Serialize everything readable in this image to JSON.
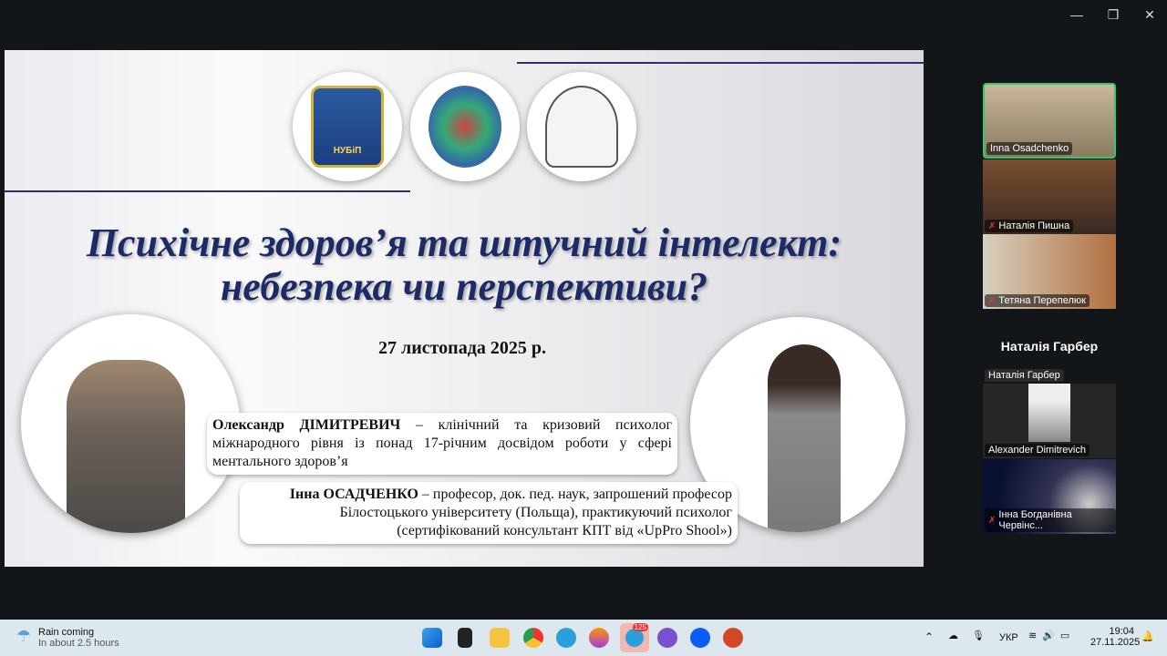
{
  "window_controls": {
    "minimize": "—",
    "restore": "❐",
    "close": "✕"
  },
  "slide": {
    "title_line1": "Психічне здоров’я та штучний інтелект:",
    "title_line2": "небезпека чи перспективи?",
    "date": "27 листопада 2025 р.",
    "speaker1": {
      "name": "Олександр ДІМИТРЕВИЧ",
      "desc": " – клінічний та кризовий психолог міжнародного рівня із понад 17-річним досвідом роботи у сфері ментального здоров’я"
    },
    "speaker2": {
      "name": "Інна ОСАДЧЕНКО",
      "desc": " – професор, док. пед. наук, запрошений професор Білостоцького університету (Польща), практикуючий психолог (сертифікований консультант КПТ від «UpPro Shool»)"
    },
    "logo1_text": "НУБіП"
  },
  "participants": [
    {
      "name": "Inna Osadchenko",
      "muted": false,
      "active": true
    },
    {
      "name": "Наталія Пишна",
      "muted": true
    },
    {
      "name": "Тетяна Перепелюк",
      "muted": true
    }
  ],
  "spotlight": {
    "heading": "Наталія Гарбер",
    "label": "Наталія Гарбер"
  },
  "participants2": [
    {
      "name": "Alexander Dimitrevich",
      "muted": false
    },
    {
      "name": "Інна Богданівна Червінс...",
      "muted": true
    }
  ],
  "taskbar": {
    "weather_title": "Rain coming",
    "weather_sub": "In about 2.5 hours",
    "telegram_badge": "125",
    "lang": "УКР",
    "time": "19:04",
    "date": "27.11.2025"
  },
  "colors": {
    "accent": "#2ecc71",
    "title": "#1c2a66",
    "taskbar": "#dde8ee"
  }
}
